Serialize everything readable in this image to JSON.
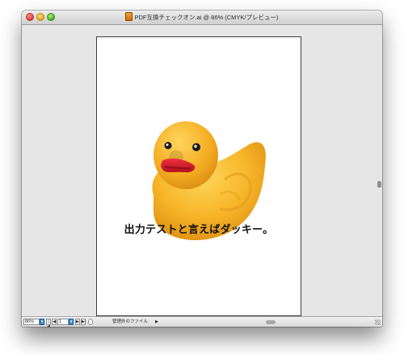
{
  "window": {
    "title": "PDF互換チェックオン.ai @ 86% (CMYK/プレビュー)"
  },
  "artboard": {
    "caption": "出力テストと言えばダッキー。",
    "image": "rubber-duck-photo"
  },
  "statusbar": {
    "zoom": "86%",
    "page": "1",
    "status": "管理外のファイル",
    "first_page": "|◀",
    "prev_page": "◀",
    "next_page": "▶",
    "last_page": "▶|",
    "dropdown": "▾",
    "status_arrow": "▶"
  },
  "colors": {
    "duck_body": "#f7b428",
    "duck_beak": "#d8182a",
    "dropdown_accent": "#3b8fd6"
  },
  "icons": [
    "close-button",
    "minimize-button",
    "zoom-button",
    "document-icon",
    "resize-grip-icon"
  ]
}
